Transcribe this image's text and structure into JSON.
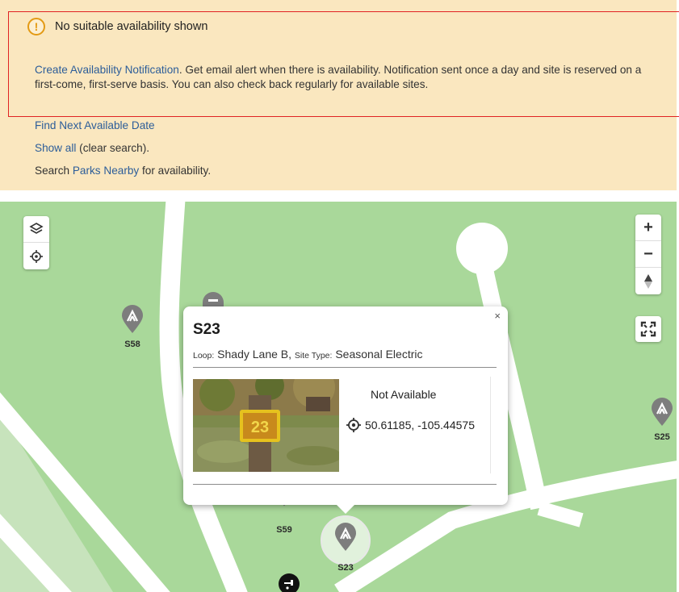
{
  "alert": {
    "title": "No suitable availability shown",
    "notification_link": "Create Availability Notification",
    "notification_text": ". Get email alert when there is availability. Notification sent once a day and site is reserved on a first-come, first-serve basis. You can also check back regularly for available sites.",
    "next_date_link": "Find Next Available Date",
    "show_all_link": "Show all",
    "show_all_text": " (clear search).",
    "nearby_prefix": "Search ",
    "nearby_link": "Parks Nearby",
    "nearby_suffix": " for availability."
  },
  "map": {
    "controls": {
      "zoom_in": "+",
      "zoom_out": "−",
      "compass": "▲"
    },
    "sites": [
      {
        "label": "S58"
      },
      {
        "label": "S25"
      },
      {
        "label": "S59"
      },
      {
        "label": "S23"
      }
    ]
  },
  "popup": {
    "close": "×",
    "title": "S23",
    "loop_label": "Loop:",
    "loop_value": "Shady Lane B,",
    "site_type_label": "Site Type:",
    "site_type_value": "Seasonal Electric",
    "photo_sign": "23",
    "status": "Not Available",
    "coordinates": "50.61185, -105.44575"
  },
  "colors": {
    "alert_bg": "#fae7bf",
    "link": "#2c5d99",
    "warning": "#e39a14",
    "highlight": "#e02222",
    "map_green": "#a9d89a",
    "marker": "#7d7d7d"
  }
}
